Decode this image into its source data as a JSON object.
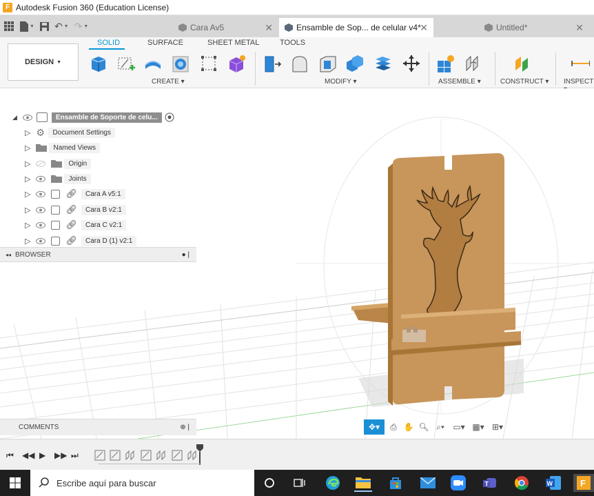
{
  "window": {
    "title": "Autodesk Fusion 360 (Education License)",
    "logo_letter": "F"
  },
  "tabs": [
    {
      "label": "Cara Av5",
      "active": false
    },
    {
      "label": "Ensamble de Sop... de celular v4*",
      "active": true
    },
    {
      "label": "Untitled*",
      "active": false
    }
  ],
  "ribbon": {
    "workspace_label": "DESIGN",
    "tabs": [
      "SOLID",
      "SURFACE",
      "SHEET METAL",
      "TOOLS"
    ],
    "active_tab": "SOLID",
    "groups": [
      "CREATE",
      "MODIFY",
      "ASSEMBLE",
      "CONSTRUCT",
      "INSPECT"
    ]
  },
  "browser": {
    "title": "BROWSER",
    "root_label": "Ensamble de Soporte de celu...",
    "items": [
      {
        "label": "Document Settings",
        "icon": "gear-icon"
      },
      {
        "label": "Named Views",
        "icon": "folder-icon"
      },
      {
        "label": "Origin",
        "icon": "folder-icon"
      },
      {
        "label": "Joints",
        "icon": "folder-icon"
      },
      {
        "label": "Cara A v5:1",
        "icon": "component-icon"
      },
      {
        "label": "Cara B v2:1",
        "icon": "component-icon"
      },
      {
        "label": "Cara C v2:1",
        "icon": "component-icon"
      },
      {
        "label": "Cara D (1) v2:1",
        "icon": "component-icon"
      }
    ]
  },
  "comments": {
    "title": "COMMENTS"
  },
  "taskbar": {
    "search_placeholder": "Escribe aquí para buscar"
  },
  "colors": {
    "accent": "#0696d7",
    "wood": "#c8955a",
    "tab_bar": "#d7d7d7",
    "taskbar": "#1f1f1f"
  }
}
